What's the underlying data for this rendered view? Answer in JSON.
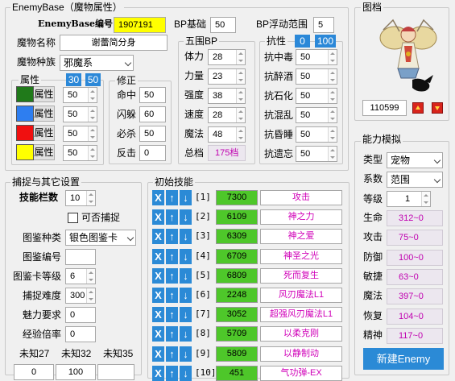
{
  "window": {
    "title": "EnemyBase（魔物属性）"
  },
  "base": {
    "id_label": "EnemyBase编号",
    "id_value": "1907191",
    "bp_label": "BP基础",
    "bp_value": "50",
    "float_label": "BP浮动范围",
    "float_value": "5"
  },
  "name": {
    "label": "魔物名称",
    "value": "谢蕾简分身"
  },
  "race": {
    "label": "魔物种族",
    "value": "邪魔系"
  },
  "attributes": {
    "title": "属性",
    "tag1": "30",
    "tag2": "50",
    "button_label": "属性",
    "rows": [
      {
        "color": "#207a1a",
        "value": "50"
      },
      {
        "color": "#2e7ef0",
        "value": "50"
      },
      {
        "color": "#f01010",
        "value": "50"
      },
      {
        "color": "#ffff00",
        "value": "50"
      }
    ]
  },
  "correction": {
    "title": "修正",
    "rows": [
      {
        "label": "命中",
        "value": "50"
      },
      {
        "label": "闪躲",
        "value": "60"
      },
      {
        "label": "必杀",
        "value": "50"
      },
      {
        "label": "反击",
        "value": "0"
      }
    ]
  },
  "bp5": {
    "title": "五围BP",
    "rows": [
      {
        "label": "体力",
        "value": "28"
      },
      {
        "label": "力量",
        "value": "23"
      },
      {
        "label": "强度",
        "value": "38"
      },
      {
        "label": "速度",
        "value": "28"
      },
      {
        "label": "魔法",
        "value": "48"
      }
    ],
    "total_label": "总档",
    "total_value": "175档"
  },
  "resist": {
    "title": "抗性",
    "tag1": "0",
    "tag2": "100",
    "rows": [
      {
        "label": "抗中毒",
        "value": "50"
      },
      {
        "label": "抗醉酒",
        "value": "50"
      },
      {
        "label": "抗石化",
        "value": "50"
      },
      {
        "label": "抗混乱",
        "value": "50"
      },
      {
        "label": "抗昏睡",
        "value": "50"
      },
      {
        "label": "抗遗忘",
        "value": "50"
      }
    ]
  },
  "image": {
    "title": "图档",
    "id_value": "110599"
  },
  "capture": {
    "title": "捕捉与其它设置",
    "skill_slots_label": "技能栏数",
    "skill_slots_value": "10",
    "catchable_label": "可否捕捉",
    "card_type_label": "图鉴种类",
    "card_type_value": "银色图鉴卡",
    "card_no_label": "图鉴编号",
    "card_no_value": "",
    "card_level_label": "图鉴卡等级",
    "card_level_value": "6",
    "difficulty_label": "捕捉难度",
    "difficulty_value": "300",
    "charm_label": "魅力要求",
    "charm_value": "0",
    "exp_label": "经验倍率",
    "exp_value": "0",
    "unknowns": [
      {
        "label": "未知27",
        "value": "0"
      },
      {
        "label": "未知32",
        "value": "100"
      },
      {
        "label": "未知35",
        "value": ""
      }
    ]
  },
  "skills": {
    "title": "初始技能",
    "delete": "X",
    "up": "↑",
    "down": "↓",
    "rows": [
      {
        "index": "[1]",
        "id": "7300",
        "name": "攻击"
      },
      {
        "index": "[2]",
        "id": "6109",
        "name": "神之力"
      },
      {
        "index": "[3]",
        "id": "6309",
        "name": "神之爱"
      },
      {
        "index": "[4]",
        "id": "6709",
        "name": "神圣之光"
      },
      {
        "index": "[5]",
        "id": "6809",
        "name": "死而复生"
      },
      {
        "index": "[6]",
        "id": "2248",
        "name": "风刃魔法L1"
      },
      {
        "index": "[7]",
        "id": "3052",
        "name": "超强风刃魔法L1"
      },
      {
        "index": "[8]",
        "id": "5709",
        "name": "以柔克刚"
      },
      {
        "index": "[9]",
        "id": "5809",
        "name": "以静制动"
      },
      {
        "index": "[10]",
        "id": "451",
        "name": "气功弹-EX"
      }
    ]
  },
  "simulate": {
    "title": "能力模拟",
    "type_label": "类型",
    "type_value": "宠物",
    "family_label": "系数",
    "family_value": "范围",
    "level_label": "等级",
    "level_value": "1",
    "stats": [
      {
        "label": "生命",
        "value": "312~0"
      },
      {
        "label": "攻击",
        "value": "75~0"
      },
      {
        "label": "防御",
        "value": "100~0"
      },
      {
        "label": "敏捷",
        "value": "63~0"
      },
      {
        "label": "魔法",
        "value": "397~0"
      },
      {
        "label": "恢复",
        "value": "104~0"
      },
      {
        "label": "精神",
        "value": "117~0"
      }
    ],
    "new_button": "新建Enemy"
  }
}
